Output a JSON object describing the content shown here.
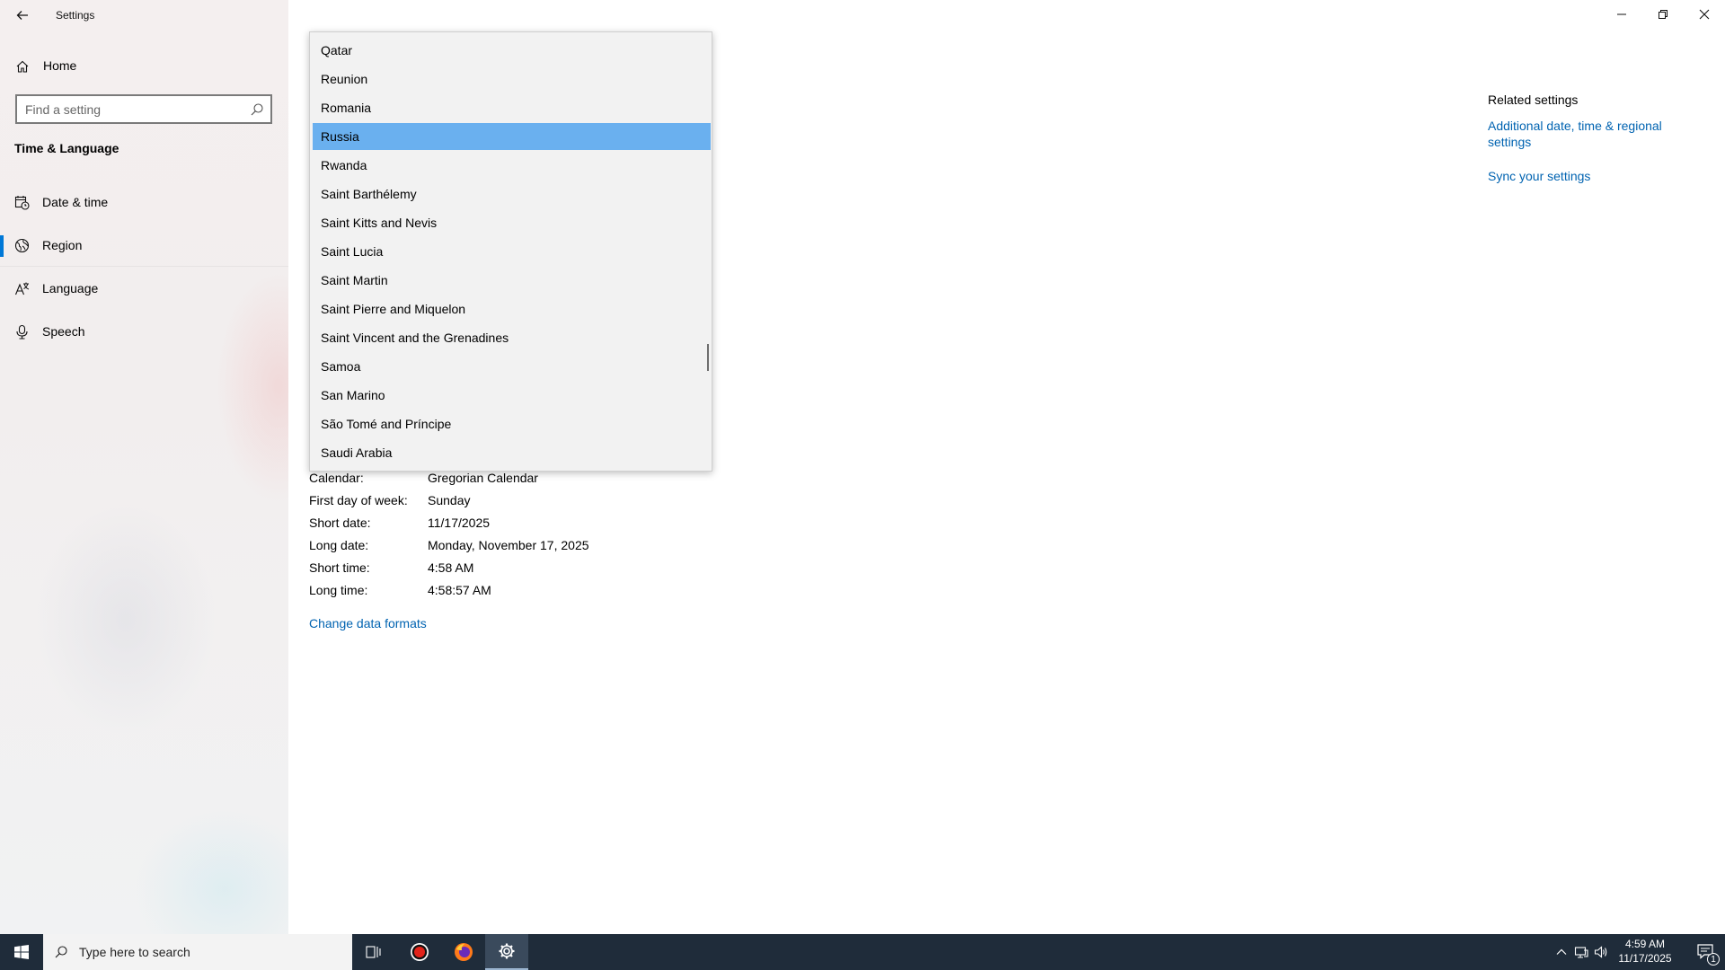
{
  "window": {
    "title": "Settings"
  },
  "nav": {
    "home_label": "Home",
    "search_placeholder": "Find a setting",
    "section_title": "Time & Language",
    "items": [
      {
        "label": "Date & time",
        "icon": "calendar-clock-icon"
      },
      {
        "label": "Region",
        "icon": "globe-icon",
        "selected": true
      },
      {
        "label": "Language",
        "icon": "language-icon"
      },
      {
        "label": "Speech",
        "icon": "microphone-icon"
      }
    ]
  },
  "dropdown": {
    "selected": "Russia",
    "items": [
      "Qatar",
      "Reunion",
      "Romania",
      "Russia",
      "Rwanda",
      "Saint Barthélemy",
      "Saint Kitts and Nevis",
      "Saint Lucia",
      "Saint Martin",
      "Saint Pierre and Miquelon",
      "Saint Vincent and the Grenadines",
      "Samoa",
      "San Marino",
      "São Tomé and Príncipe",
      "Saudi Arabia"
    ]
  },
  "formats": {
    "rows": [
      {
        "key": "Calendar:",
        "value": "Gregorian Calendar"
      },
      {
        "key": "First day of week:",
        "value": "Sunday"
      },
      {
        "key": "Short date:",
        "value": "11/17/2025"
      },
      {
        "key": "Long date:",
        "value": "Monday, November 17, 2025"
      },
      {
        "key": "Short time:",
        "value": "4:58 AM"
      },
      {
        "key": "Long time:",
        "value": "4:58:57 AM"
      }
    ],
    "change_link": "Change data formats"
  },
  "related": {
    "header": "Related settings",
    "link_additional": "Additional date, time & regional settings",
    "link_sync": "Sync your settings"
  },
  "taskbar": {
    "search_placeholder": "Type here to search",
    "clock_time": "4:59 AM",
    "clock_date": "11/17/2025",
    "notification_count": "1"
  },
  "colors": {
    "accent": "#0078d7",
    "link": "#0063b1",
    "selected_item": "#6ab0ef",
    "taskbar": "#1f2c3a"
  }
}
